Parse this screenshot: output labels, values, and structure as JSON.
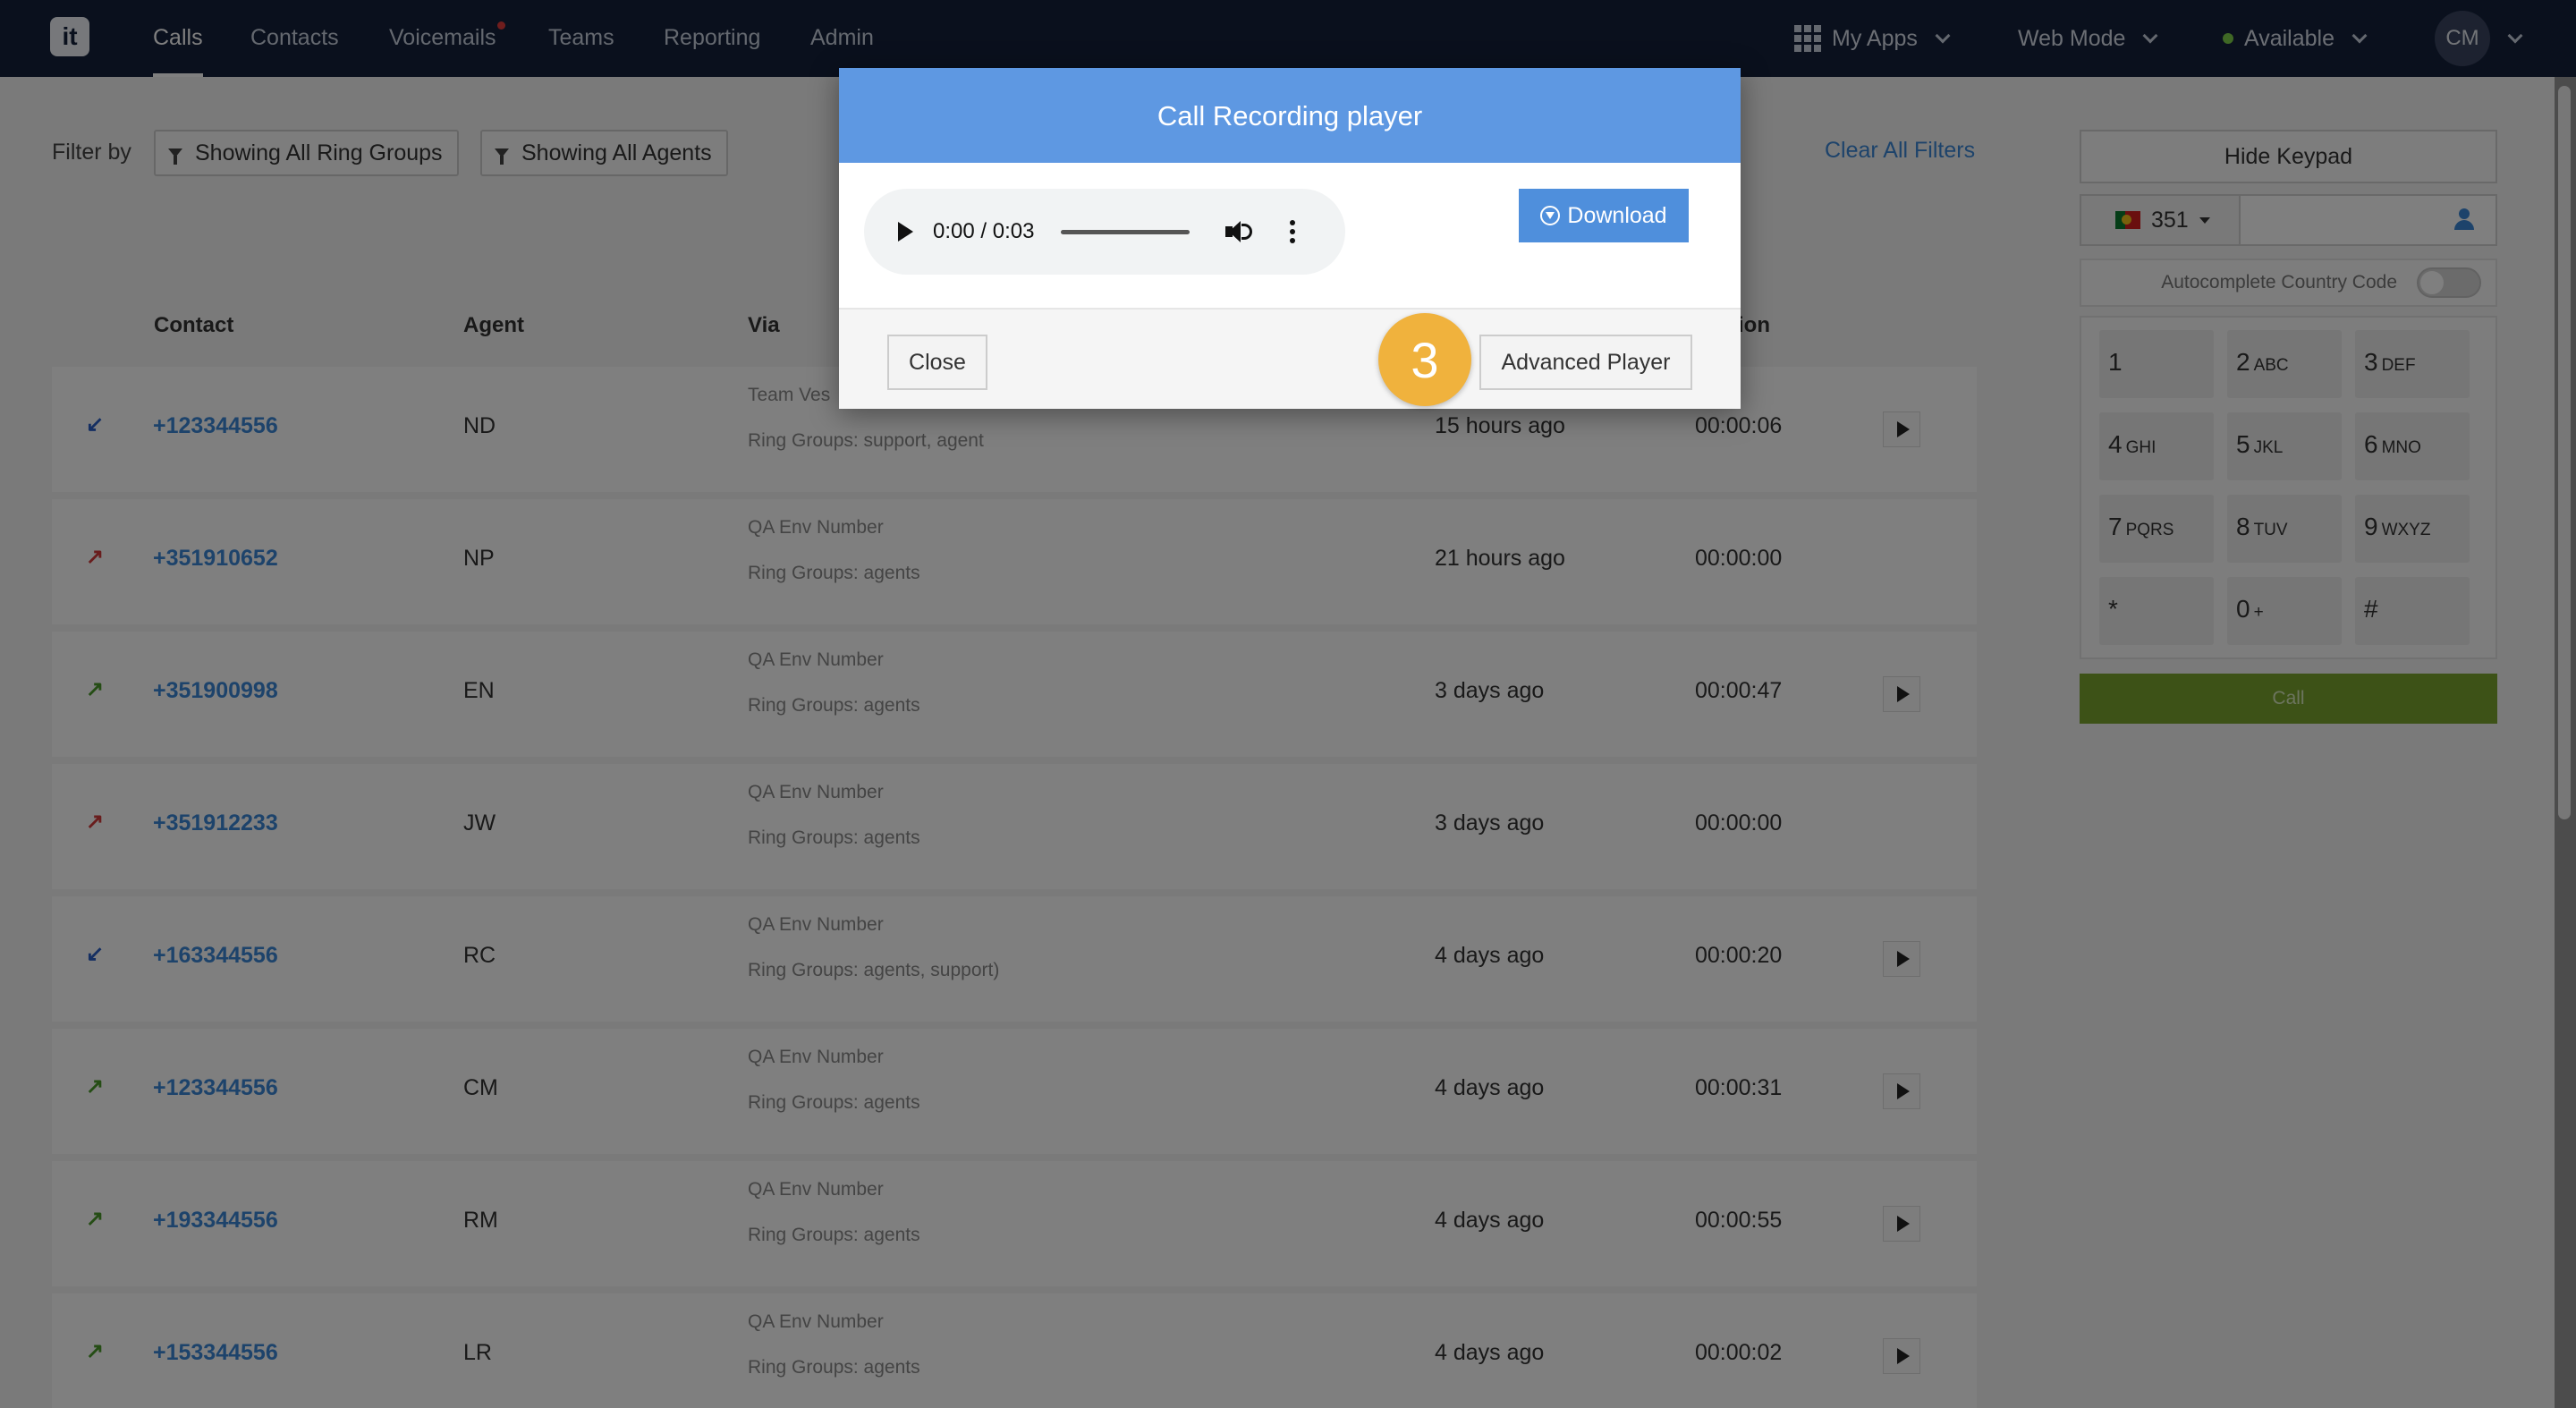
{
  "app": {
    "logo_text": "it",
    "nav": [
      {
        "label": "Calls",
        "active": true
      },
      {
        "label": "Contacts"
      },
      {
        "label": "Voicemails",
        "has_notification": true
      },
      {
        "label": "Teams"
      },
      {
        "label": "Reporting"
      },
      {
        "label": "Admin"
      }
    ],
    "my_apps": "My Apps",
    "mode": "Web Mode",
    "status": "Available",
    "user_initials": "CM"
  },
  "filters": {
    "label": "Filter by",
    "ring_groups": "Showing All Ring Groups",
    "agents": "Showing All Agents",
    "clear_all": "Clear All Filters"
  },
  "table": {
    "headers": {
      "contact": "Contact",
      "agent": "Agent",
      "via": "Via",
      "duration_partial": "tion"
    },
    "rows": [
      {
        "direction": "incoming",
        "contact": "+123344556",
        "agent": "ND",
        "via": "Team Ves",
        "ring_groups": "Ring Groups: support, agent",
        "when": "15 hours ago",
        "duration": "00:00:06",
        "has_recording": true
      },
      {
        "direction": "missed",
        "contact": "+351910652",
        "agent": "NP",
        "via": "QA Env Number",
        "ring_groups": "Ring Groups: agents",
        "when": "21 hours ago",
        "duration": "00:00:00",
        "has_recording": false
      },
      {
        "direction": "outgoing",
        "contact": "+351900998",
        "agent": "EN",
        "via": "QA Env Number",
        "ring_groups": "Ring Groups: agents",
        "when": "3 days ago",
        "duration": "00:00:47",
        "has_recording": true
      },
      {
        "direction": "missed",
        "contact": "+351912233",
        "agent": "JW",
        "via": "QA Env Number",
        "ring_groups": "Ring Groups: agents",
        "when": "3 days ago",
        "duration": "00:00:00",
        "has_recording": false
      },
      {
        "direction": "incoming",
        "contact": "+163344556",
        "agent": "RC",
        "via": "QA Env Number",
        "ring_groups": "Ring Groups: agents, support)",
        "when": "4 days ago",
        "duration": "00:00:20",
        "has_recording": true
      },
      {
        "direction": "outgoing",
        "contact": "+123344556",
        "agent": "CM",
        "via": "QA Env Number",
        "ring_groups": "Ring Groups: agents",
        "when": "4 days ago",
        "duration": "00:00:31",
        "has_recording": true
      },
      {
        "direction": "outgoing",
        "contact": "+193344556",
        "agent": "RM",
        "via": "QA Env Number",
        "ring_groups": "Ring Groups: agents",
        "when": "4 days ago",
        "duration": "00:00:55",
        "has_recording": true
      },
      {
        "direction": "outgoing",
        "contact": "+153344556",
        "agent": "LR",
        "via": "QA Env Number",
        "ring_groups": "Ring Groups: agents",
        "when": "4 days ago",
        "duration": "00:00:02",
        "has_recording": true
      }
    ]
  },
  "keypad": {
    "hide_label": "Hide Keypad",
    "country_code": "351",
    "autocomplete_label": "Autocomplete Country Code",
    "keys": [
      {
        "digit": "1",
        "letters": ""
      },
      {
        "digit": "2",
        "letters": "ABC"
      },
      {
        "digit": "3",
        "letters": "DEF"
      },
      {
        "digit": "4",
        "letters": "GHI"
      },
      {
        "digit": "5",
        "letters": "JKL"
      },
      {
        "digit": "6",
        "letters": "MNO"
      },
      {
        "digit": "7",
        "letters": "PQRS"
      },
      {
        "digit": "8",
        "letters": "TUV"
      },
      {
        "digit": "9",
        "letters": "WXYZ"
      },
      {
        "digit": "*",
        "letters": ""
      },
      {
        "digit": "0",
        "letters": "+"
      },
      {
        "digit": "#",
        "letters": ""
      }
    ],
    "call_label": "Call"
  },
  "modal": {
    "title": "Call Recording player",
    "audio_time": "0:00 / 0:03",
    "download_label": "Download",
    "close_label": "Close",
    "advanced_label": "Advanced Player",
    "step_badge": "3"
  },
  "colors": {
    "topbar": "#14213b",
    "modal_header": "#5e98e2",
    "download": "#4f8fdc",
    "badge": "#f0b23d",
    "link": "#3b87d6",
    "call_button": "#7aa52f",
    "incoming_icon": "#2a5fc4",
    "missed_icon": "#d23a3a",
    "outgoing_icon": "#4a9a2a"
  }
}
